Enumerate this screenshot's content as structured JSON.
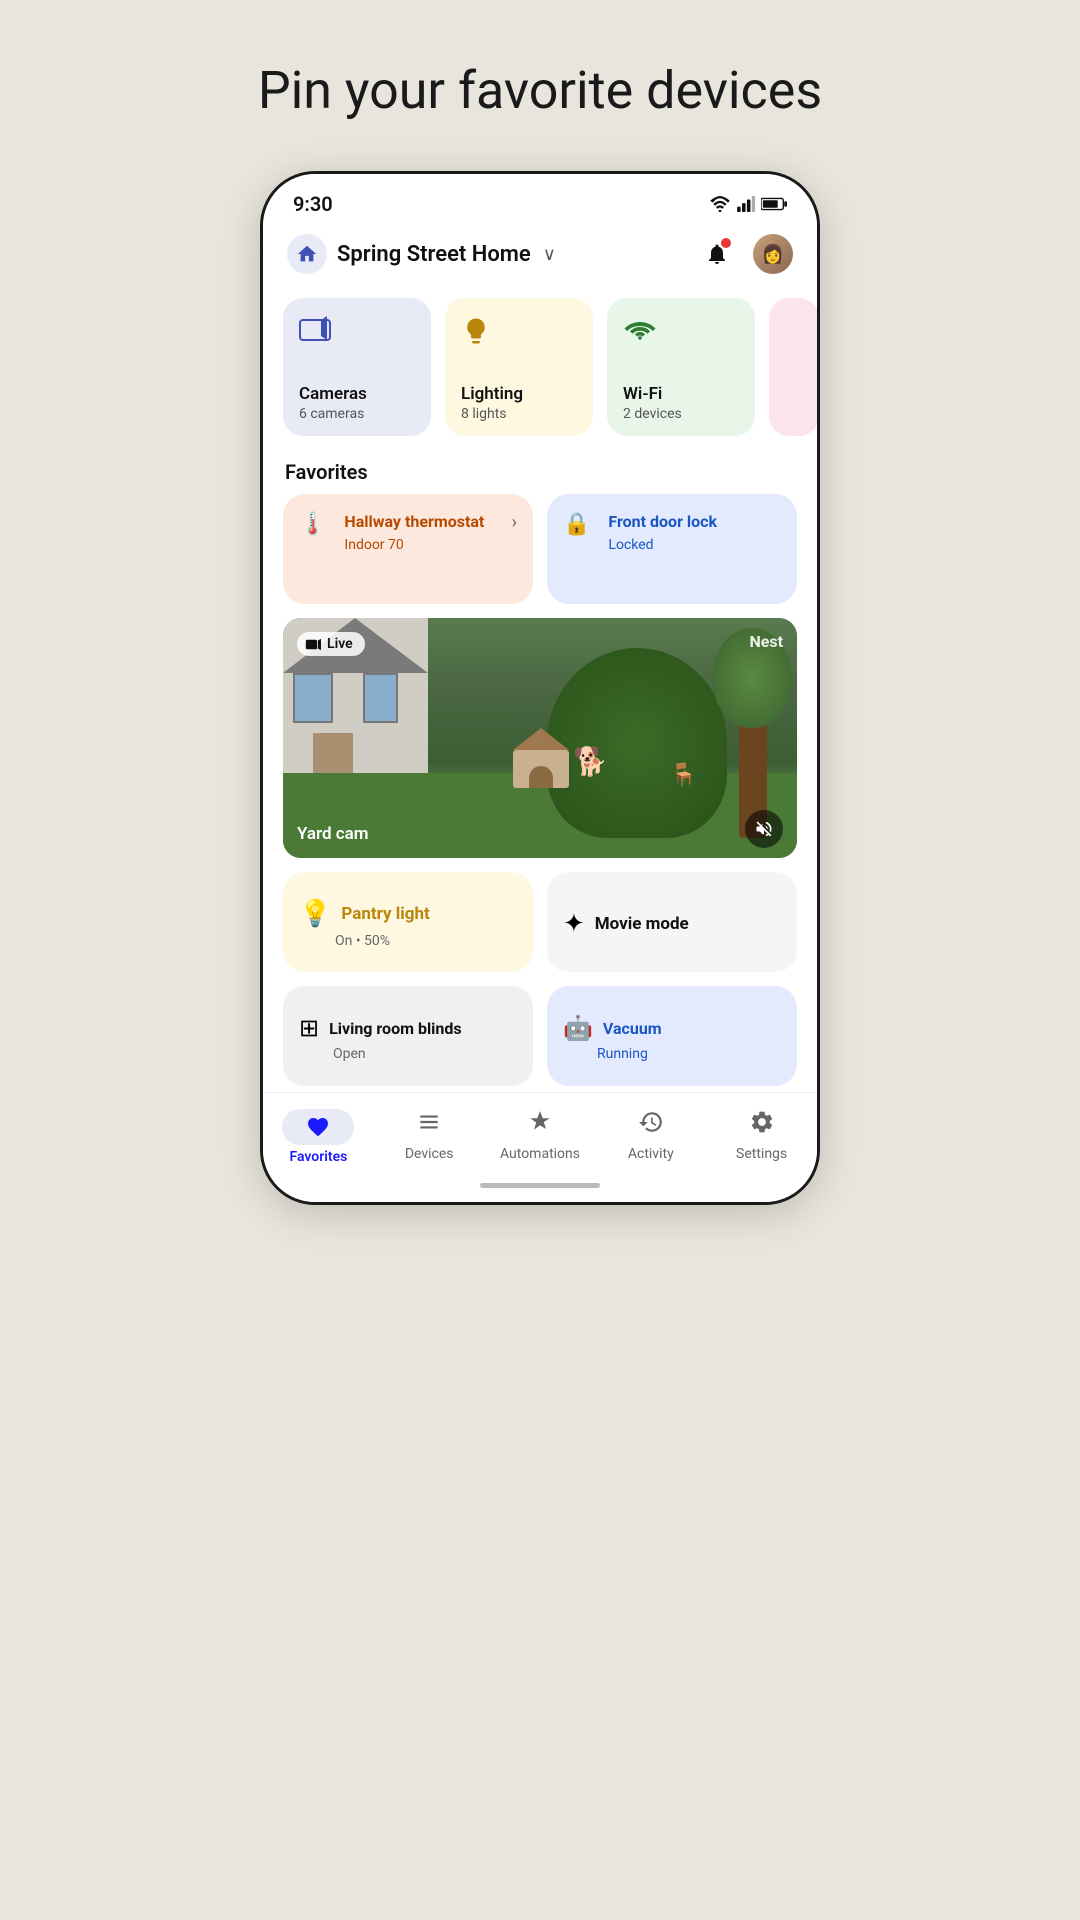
{
  "page": {
    "title": "Pin your favorite devices"
  },
  "statusBar": {
    "time": "9:30"
  },
  "header": {
    "homeName": "Spring Street Home",
    "homeIconAlt": "home-icon"
  },
  "categories": [
    {
      "id": "cameras",
      "name": "Cameras",
      "count": "6 cameras",
      "icon": "📹",
      "colorClass": "cameras"
    },
    {
      "id": "lighting",
      "name": "Lighting",
      "count": "8 lights",
      "icon": "💡",
      "colorClass": "lighting"
    },
    {
      "id": "wifi",
      "name": "Wi-Fi",
      "count": "2 devices",
      "icon": "📶",
      "colorClass": "wifi"
    }
  ],
  "favorites": {
    "label": "Favorites",
    "items": [
      {
        "id": "hallway-thermostat",
        "name": "Hallway thermostat",
        "status": "Indoor 70",
        "icon": "🌡️",
        "type": "thermostat"
      },
      {
        "id": "front-door-lock",
        "name": "Front door lock",
        "status": "Locked",
        "icon": "🔒",
        "type": "door-lock"
      }
    ]
  },
  "cameraFeed": {
    "label": "Yard cam",
    "badge": "Live",
    "brand": "Nest",
    "muteIcon": "🔇"
  },
  "bottomCards": [
    {
      "id": "pantry-light",
      "name": "Pantry light",
      "status": "On • 50%",
      "icon": "💡",
      "type": "pantry"
    },
    {
      "id": "movie-mode",
      "name": "Movie mode",
      "icon": "✨",
      "type": "movie"
    }
  ],
  "bottomCards2": [
    {
      "id": "living-room-blinds",
      "name": "Living room blinds",
      "status": "Open",
      "icon": "⊞",
      "type": "blinds"
    },
    {
      "id": "vacuum",
      "name": "Vacuum",
      "status": "Running",
      "icon": "🤖",
      "type": "vacuum"
    }
  ],
  "bottomNav": [
    {
      "id": "favorites",
      "label": "Favorites",
      "icon": "♥",
      "active": true
    },
    {
      "id": "devices",
      "label": "Devices",
      "icon": "⊡",
      "active": false
    },
    {
      "id": "automations",
      "label": "Automations",
      "icon": "✦",
      "active": false
    },
    {
      "id": "activity",
      "label": "Activity",
      "icon": "◷",
      "active": false
    },
    {
      "id": "settings",
      "label": "Settings",
      "icon": "⚙",
      "active": false
    }
  ]
}
